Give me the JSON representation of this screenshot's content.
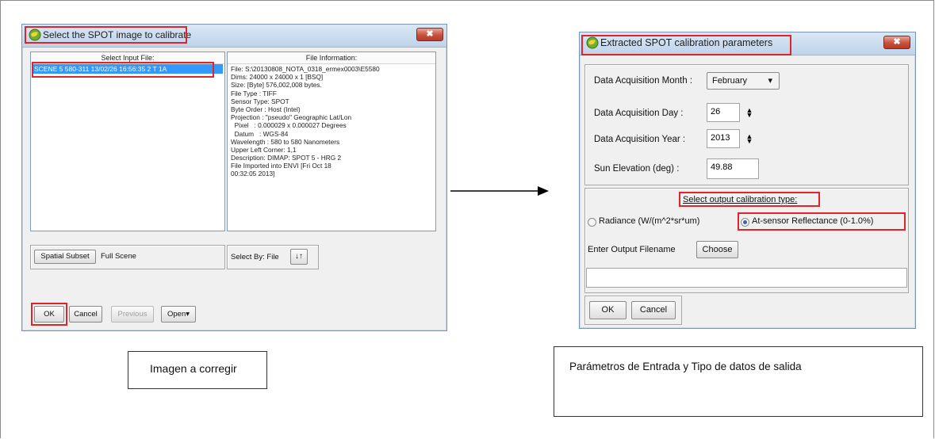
{
  "dialog1": {
    "title": "Select the SPOT image to calibrate",
    "close_label": "✖",
    "select_input_header": "Select Input File:",
    "file_info_header": "File Information:",
    "selected_file": "SCENE 5 580-311 13/02/26 16:56:35 2 T 1A",
    "file_info_lines": [
      "File: S:\\20130808_NOTA_0318_ermex0003\\E5580",
      "Dims: 24000 x 24000 x 1 [BSQ]",
      "Size: [Byte] 576,002,008 bytes.",
      "File Type : TIFF",
      "Sensor Type: SPOT",
      "Byte Order : Host (Intel)",
      "Projection : \"pseudo\" Geographic Lat/Lon",
      "  Pixel   : 0.000029 x 0.000027 Degrees",
      "  Datum   : WGS-84",
      "Wavelength : 580 to 580 Nanometers",
      "Upper Left Corner: 1,1",
      "Description: DIMAP: SPOT 5 - HRG 2",
      "File Imported into ENVI [Fri Oct 18",
      "00:32:05 2013]"
    ],
    "spatial_subset_button": "Spatial Subset",
    "spatial_subset_value": "Full Scene",
    "select_by_label": "Select By: File",
    "sort_icon_glyph": "↓↑",
    "ok_button": "OK",
    "cancel_button": "Cancel",
    "previous_button": "Previous",
    "open_button": "Open▾"
  },
  "dialog2": {
    "title": "Extracted SPOT calibration parameters",
    "close_label": "✖",
    "month_label": "Data Acquisition Month :",
    "month_value": "February",
    "month_arrow": "▾",
    "day_label": "Data Acquisition Day :",
    "day_value": "26",
    "year_label": "Data Acquisition Year :",
    "year_value": "2013",
    "sun_label": "Sun Elevation (deg) :",
    "sun_value": "49.88",
    "spin_glyph": "▲▼",
    "output_type_label": "Select output calibration type:",
    "radiance_label": "Radiance (W/(m^2*sr*um)",
    "reflectance_label": "At-sensor Reflectance (0-1.0%)",
    "reflectance_selected": true,
    "filename_label": "Enter Output Filename",
    "choose_button": "Choose",
    "filename_value": "",
    "ok_button": "OK",
    "cancel_button": "Cancel"
  },
  "captions": {
    "left": "Imagen a corregir",
    "right": "Parámetros de Entrada y Tipo de datos de salida"
  },
  "colors": {
    "highlight_red": "#e0242b",
    "selection_blue": "#3399ff"
  }
}
